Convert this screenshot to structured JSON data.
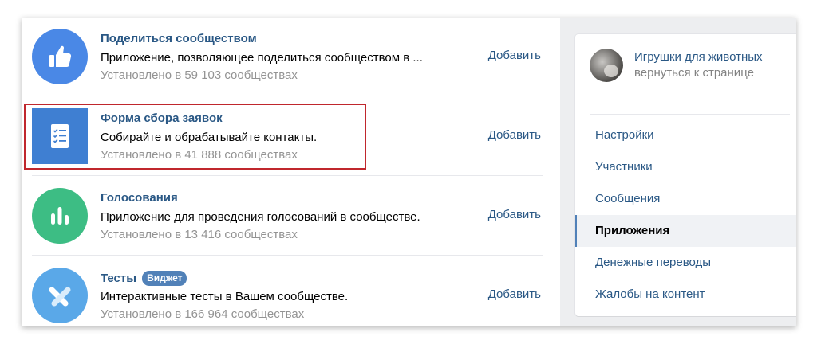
{
  "apps": [
    {
      "title": "Поделиться сообществом",
      "description": "Приложение, позволяющее поделиться сообществом в ...",
      "installs": "Установлено в 59 103 сообществах",
      "action": "Добавить",
      "icon": "thumbs-up-icon",
      "icon_color": "#4a88e6"
    },
    {
      "title": "Форма сбора заявок",
      "description": "Собирайте и обрабатывайте контакты.",
      "installs": "Установлено в 41 888 сообществах",
      "action": "Добавить",
      "icon": "checklist-icon",
      "icon_color": "#3f7fd2"
    },
    {
      "title": "Голосования",
      "description": "Приложение для проведения голосований в сообществе.",
      "installs": "Установлено в 13 416 сообществах",
      "action": "Добавить",
      "icon": "bar-chart-icon",
      "icon_color": "#3dbd84"
    },
    {
      "title": "Тесты",
      "badge": "Виджет",
      "description": "Интерактивные тесты в Вашем сообществе.",
      "installs": "Установлено в 166 964 сообществах",
      "action": "Добавить",
      "icon": "cross-icon",
      "icon_color": "#5aa8e8"
    }
  ],
  "community": {
    "name": "Игрушки для животных",
    "back_link": "вернуться к странице"
  },
  "menu": {
    "items": [
      {
        "label": "Настройки",
        "active": false
      },
      {
        "label": "Участники",
        "active": false
      },
      {
        "label": "Сообщения",
        "active": false
      },
      {
        "label": "Приложения",
        "active": true
      },
      {
        "label": "Денежные переводы",
        "active": false
      },
      {
        "label": "Жалобы на контент",
        "active": false
      }
    ]
  },
  "colors": {
    "link": "#2a5885",
    "muted": "#939393",
    "highlight": "#c0272d",
    "badge": "#5181b8"
  }
}
